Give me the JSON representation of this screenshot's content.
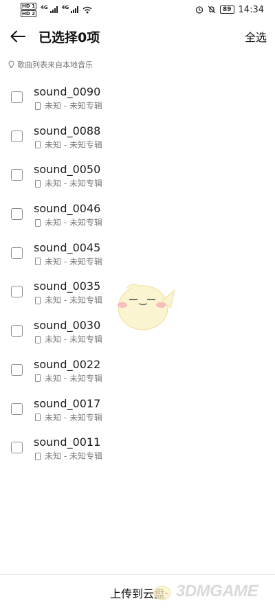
{
  "status_bar": {
    "sim1": "HD 1",
    "sim2": "HD 2",
    "net1": "4G",
    "net2": "4G",
    "battery": "89",
    "time": "14:34"
  },
  "header": {
    "title": "已选择0项",
    "select_all": "全选"
  },
  "hint": "歌曲列表来自本地音乐",
  "songs": [
    {
      "title": "sound_0090",
      "subtitle": "未知 - 未知专辑"
    },
    {
      "title": "sound_0088",
      "subtitle": "未知 - 未知专辑"
    },
    {
      "title": "sound_0050",
      "subtitle": "未知 - 未知专辑"
    },
    {
      "title": "sound_0046",
      "subtitle": "未知 - 未知专辑"
    },
    {
      "title": "sound_0045",
      "subtitle": "未知 - 未知专辑"
    },
    {
      "title": "sound_0035",
      "subtitle": "未知 - 未知专辑"
    },
    {
      "title": "sound_0030",
      "subtitle": "未知 - 未知专辑"
    },
    {
      "title": "sound_0022",
      "subtitle": "未知 - 未知专辑"
    },
    {
      "title": "sound_0017",
      "subtitle": "未知 - 未知专辑"
    },
    {
      "title": "sound_0011",
      "subtitle": "未知 - 未知专辑"
    }
  ],
  "bottom": {
    "upload_label": "上传到云盘"
  },
  "watermark": "3DMGAME",
  "icons": {
    "back": "back-arrow-icon",
    "hint": "lightbulb-icon",
    "song": "phone-icon"
  }
}
